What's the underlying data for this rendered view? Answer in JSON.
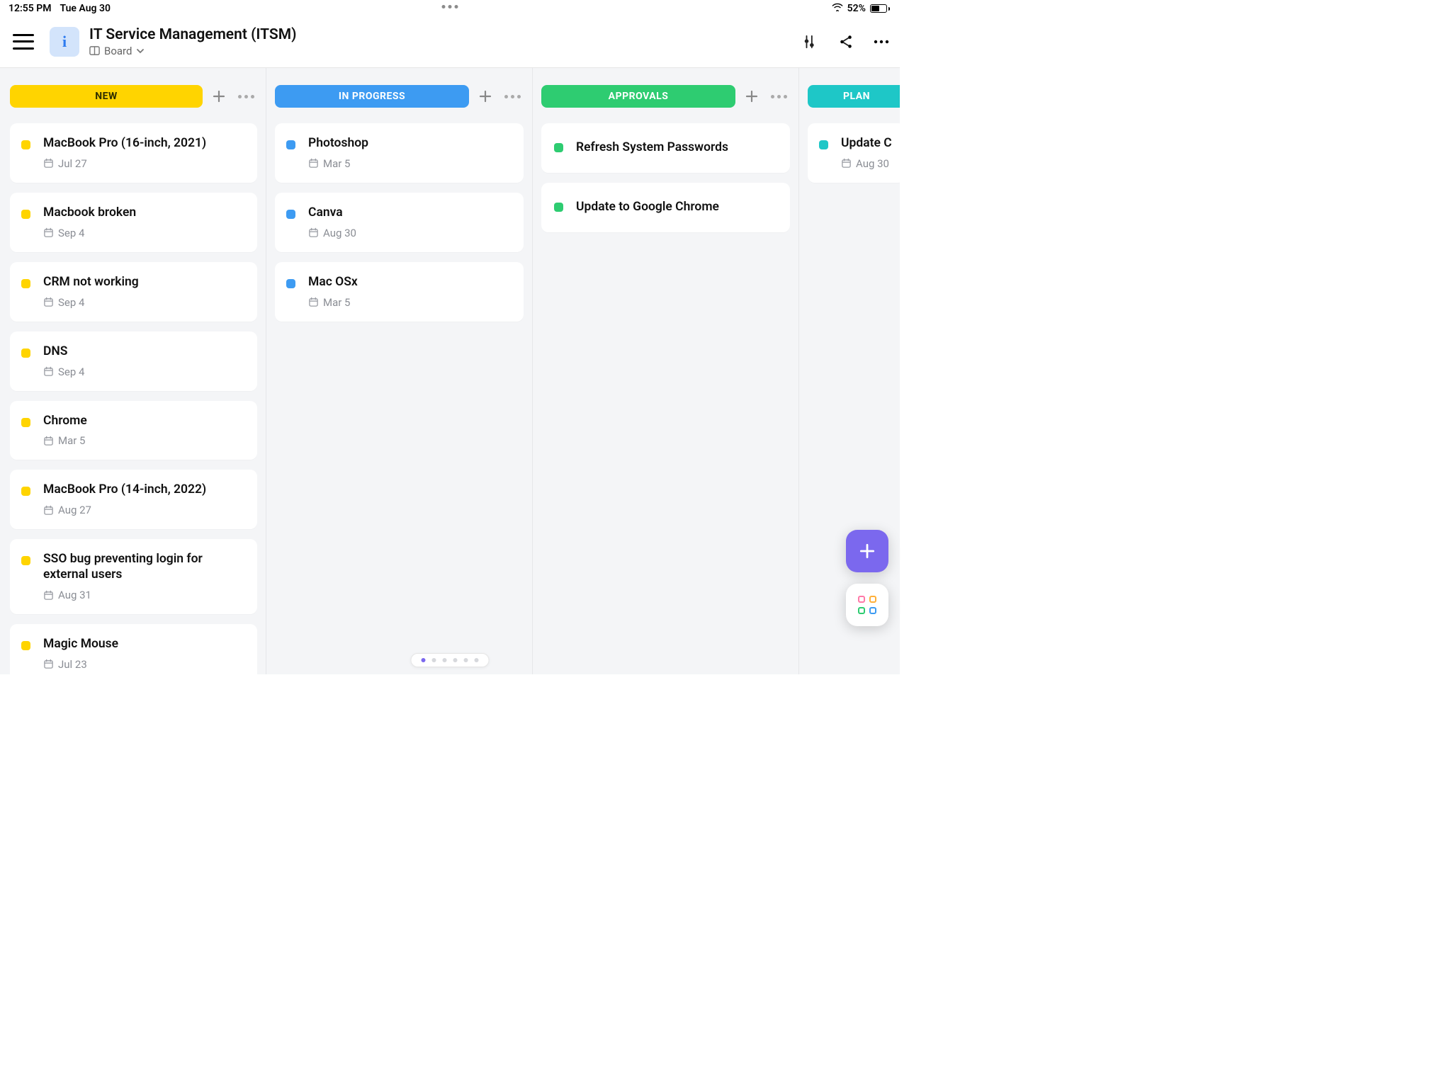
{
  "status": {
    "time": "12:55 PM",
    "date": "Tue Aug 30",
    "battery_pct": "52%"
  },
  "header": {
    "title": "IT Service Management (ITSM)",
    "view_label": "Board"
  },
  "columns": [
    {
      "label": "NEW",
      "pill_bg": "#ffd400",
      "pill_fg": "#2e2e00",
      "bullet": "#ffd400",
      "cards": [
        {
          "title": "MacBook Pro (16-inch, 2021)",
          "date": "Jul 27"
        },
        {
          "title": "Macbook broken",
          "date": "Sep 4"
        },
        {
          "title": "CRM not working",
          "date": "Sep 4"
        },
        {
          "title": "DNS",
          "date": "Sep 4"
        },
        {
          "title": "Chrome",
          "date": "Mar 5"
        },
        {
          "title": "MacBook Pro (14-inch, 2022)",
          "date": "Aug 27"
        },
        {
          "title": "SSO bug preventing login for external users",
          "date": "Aug 31"
        },
        {
          "title": "Magic Mouse",
          "date": "Jul 23"
        }
      ]
    },
    {
      "label": "IN PROGRESS",
      "pill_bg": "#3d9bf2",
      "pill_fg": "#ffffff",
      "bullet": "#3d9bf2",
      "cards": [
        {
          "title": "Photoshop",
          "date": "Mar 5"
        },
        {
          "title": "Canva",
          "date": "Aug 30"
        },
        {
          "title": "Mac OSx",
          "date": "Mar 5"
        }
      ]
    },
    {
      "label": "APPROVALS",
      "pill_bg": "#2ecc71",
      "pill_fg": "#ffffff",
      "bullet": "#2ecc71",
      "cards": [
        {
          "title": "Refresh System Passwords"
        },
        {
          "title": "Update to Google Chrome"
        }
      ]
    },
    {
      "label": "PLAN",
      "pill_bg": "#1ec7c7",
      "pill_fg": "#ffffff",
      "bullet": "#1ec7c7",
      "partial": true,
      "cards": [
        {
          "title": "Update C",
          "date": "Aug 30"
        }
      ]
    }
  ]
}
